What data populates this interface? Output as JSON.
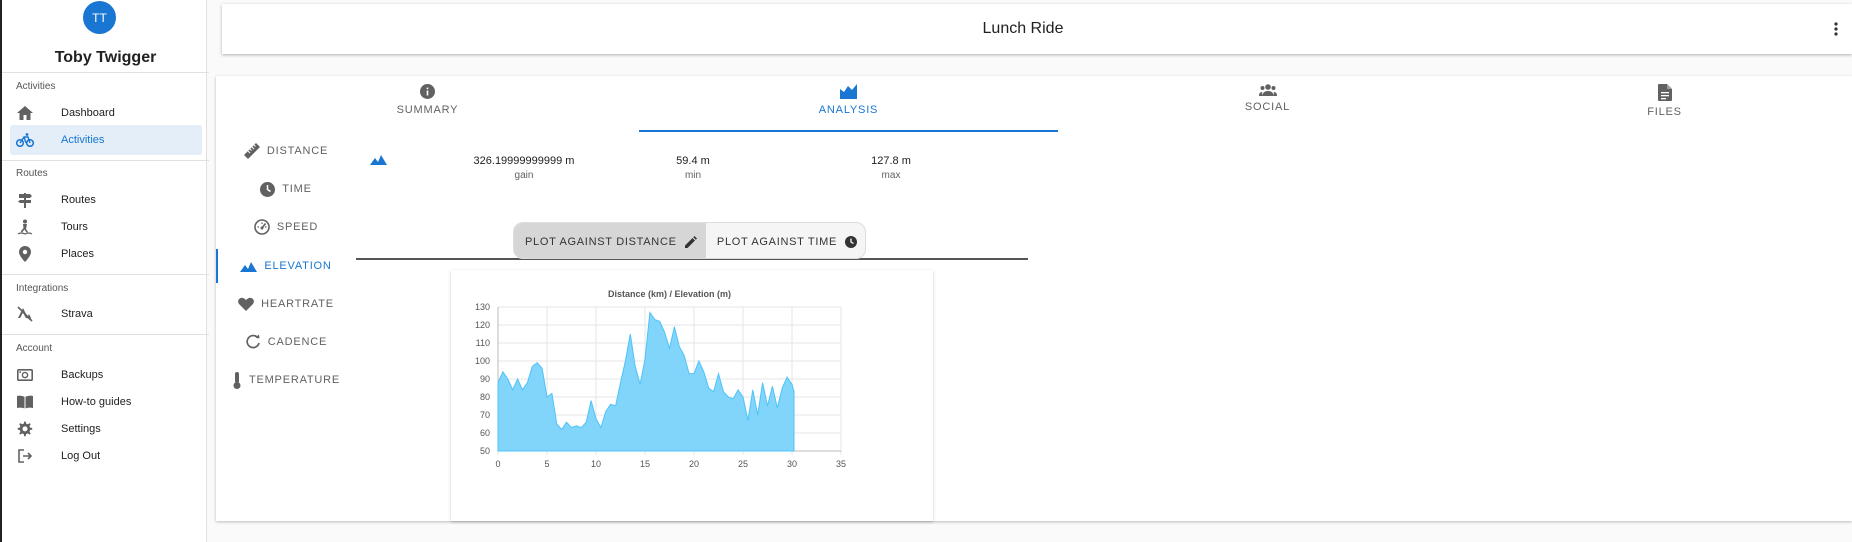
{
  "user": {
    "initials": "TT",
    "name": "Toby Twigger"
  },
  "sidebar": {
    "sections": [
      {
        "title": "Activities",
        "items": [
          {
            "label": "Dashboard",
            "icon": "home-icon"
          },
          {
            "label": "Activities",
            "icon": "bike-icon",
            "active": true
          }
        ]
      },
      {
        "title": "Routes",
        "items": [
          {
            "label": "Routes",
            "icon": "signpost-icon"
          },
          {
            "label": "Tours",
            "icon": "hiker-icon"
          },
          {
            "label": "Places",
            "icon": "pin-icon"
          }
        ]
      },
      {
        "title": "Integrations",
        "items": [
          {
            "label": "Strava",
            "icon": "strava-icon"
          }
        ]
      },
      {
        "title": "Account",
        "items": [
          {
            "label": "Backups",
            "icon": "backup-icon"
          },
          {
            "label": "How-to guides",
            "icon": "book-icon"
          },
          {
            "label": "Settings",
            "icon": "gear-icon"
          },
          {
            "label": "Log Out",
            "icon": "logout-icon"
          }
        ]
      }
    ]
  },
  "header": {
    "title": "Lunch Ride"
  },
  "tabs": [
    {
      "label": "SUMMARY",
      "icon": "info-icon"
    },
    {
      "label": "ANALYSIS",
      "icon": "area-chart-icon",
      "active": true
    },
    {
      "label": "SOCIAL",
      "icon": "people-icon"
    },
    {
      "label": "FILES",
      "icon": "file-icon"
    }
  ],
  "metrics": [
    {
      "label": "DISTANCE",
      "icon": "ruler-icon"
    },
    {
      "label": "TIME",
      "icon": "clock-icon"
    },
    {
      "label": "SPEED",
      "icon": "speedometer-icon"
    },
    {
      "label": "ELEVATION",
      "icon": "mountain-icon",
      "active": true
    },
    {
      "label": "HEARTRATE",
      "icon": "heart-icon"
    },
    {
      "label": "CADENCE",
      "icon": "rotate-icon"
    },
    {
      "label": "TEMPERATURE",
      "icon": "thermometer-icon"
    }
  ],
  "stats": [
    {
      "value": "326.19999999999 m",
      "label": "gain"
    },
    {
      "value": "59.4 m",
      "label": "min"
    },
    {
      "value": "127.8 m",
      "label": "max"
    }
  ],
  "plot_toggle": {
    "distance_label": "PLOT AGAINST DISTANCE",
    "time_label": "PLOT AGAINST TIME",
    "selected": "distance"
  },
  "colors": {
    "accent": "#1976d2",
    "area_fill": "#81d4fa",
    "area_stroke": "#4fc3f7"
  },
  "chart_data": {
    "type": "area",
    "title": "Distance (km) / Elevation (m)",
    "xlim": [
      0,
      35
    ],
    "ylim": [
      50,
      130
    ],
    "xticks": [
      0,
      5,
      10,
      15,
      20,
      25,
      30,
      35
    ],
    "yticks": [
      50,
      60,
      70,
      80,
      90,
      100,
      110,
      120,
      130
    ],
    "grid": true,
    "x": [
      0,
      0.5,
      1,
      1.5,
      2,
      2.5,
      3,
      3.5,
      4,
      4.5,
      5,
      5.5,
      6,
      6.5,
      7,
      7.5,
      8,
      8.5,
      9,
      9.5,
      10,
      10.5,
      11,
      11.5,
      12,
      12.5,
      13,
      13.5,
      14,
      14.5,
      15,
      15.5,
      16,
      16.5,
      17,
      17.5,
      18,
      18.5,
      19,
      19.5,
      20,
      20.5,
      21,
      21.5,
      22,
      22.5,
      23,
      23.5,
      24,
      24.5,
      25,
      25.5,
      26,
      26.5,
      27,
      27.5,
      28,
      28.5,
      29,
      29.5,
      30,
      30.2
    ],
    "y": [
      88,
      94,
      90,
      84,
      90,
      84,
      88,
      97,
      99,
      96,
      80,
      82,
      65,
      62,
      66,
      63,
      64,
      63,
      66,
      78,
      68,
      63,
      72,
      76,
      75,
      88,
      100,
      115,
      97,
      87,
      101,
      127,
      123,
      122,
      116,
      107,
      119,
      108,
      103,
      93,
      93,
      100,
      94,
      85,
      83,
      93,
      83,
      80,
      79,
      84,
      80,
      67,
      84,
      70,
      88,
      75,
      86,
      74,
      85,
      91,
      87,
      83
    ]
  }
}
